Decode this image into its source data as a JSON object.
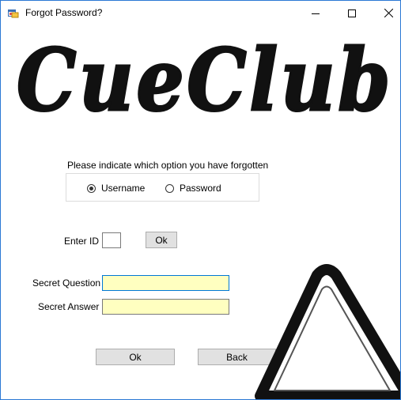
{
  "window": {
    "title": "Forgot Password?",
    "controls": [
      "minimize-icon",
      "maximize-icon",
      "close-icon"
    ]
  },
  "logo": {
    "text": "CueClub"
  },
  "options": {
    "prompt": "Please indicate which option you have forgotten",
    "username_label": "Username",
    "password_label": "Password",
    "selected": "Username"
  },
  "id_section": {
    "label": "Enter ID",
    "value": "",
    "ok_label": "Ok"
  },
  "secret": {
    "question_label": "Secret Question",
    "question_value": "",
    "answer_label": "Secret Answer",
    "answer_value": ""
  },
  "footer": {
    "ok_label": "Ok",
    "back_label": "Back"
  },
  "colors": {
    "window_border": "#2b78d4",
    "input_background": "#ffffc0",
    "button_background": "#e1e1e1",
    "focus_border": "#0078d7"
  },
  "decorations": {
    "rack_icon": "billiard-rack-icon"
  }
}
